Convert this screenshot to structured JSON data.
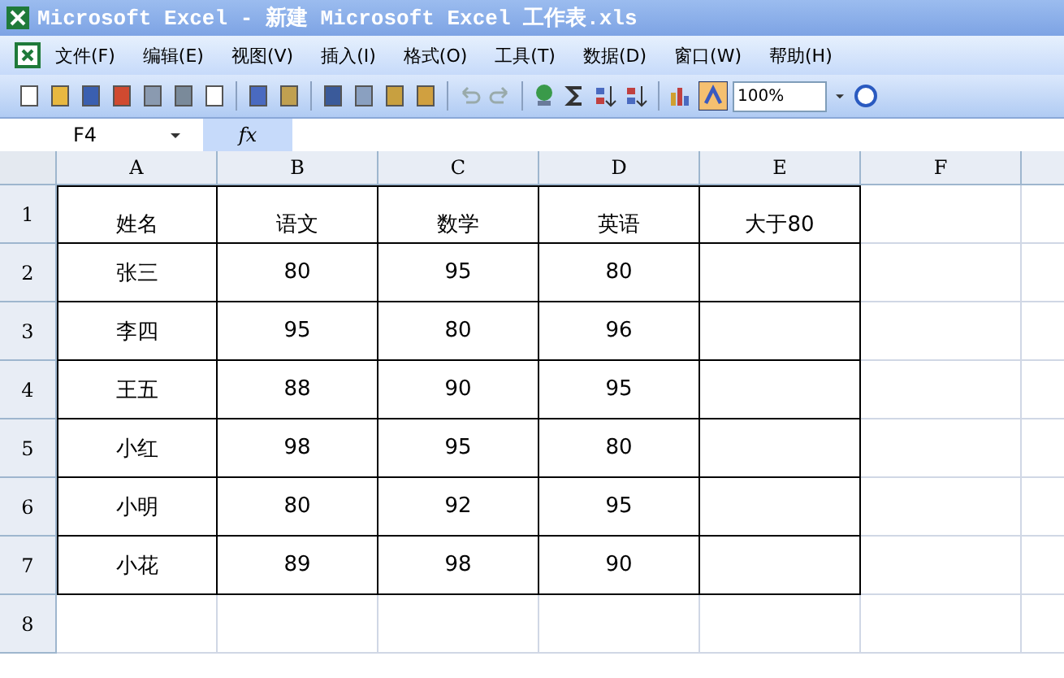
{
  "window": {
    "title": "Microsoft Excel - 新建 Microsoft Excel 工作表.xls"
  },
  "menu": [
    "文件(F)",
    "编辑(E)",
    "视图(V)",
    "插入(I)",
    "格式(O)",
    "工具(T)",
    "数据(D)",
    "窗口(W)",
    "帮助(H)"
  ],
  "toolbar": {
    "zoom": "100%"
  },
  "formula_bar": {
    "name_box": "F4",
    "fx": "fx"
  },
  "sheet": {
    "columns": [
      "A",
      "B",
      "C",
      "D",
      "E",
      "F"
    ],
    "rows": [
      {
        "number": "1",
        "cells": [
          "姓名",
          "语文",
          "数学",
          "英语",
          "大于80"
        ]
      },
      {
        "number": "2",
        "cells": [
          "张三",
          "80",
          "95",
          "80"
        ]
      },
      {
        "number": "3",
        "cells": [
          "李四",
          "95",
          "80",
          "96"
        ]
      },
      {
        "number": "4",
        "cells": [
          "王五",
          "88",
          "90",
          "95"
        ]
      },
      {
        "number": "5",
        "cells": [
          "小红",
          "98",
          "95",
          "80"
        ]
      },
      {
        "number": "6",
        "cells": [
          "小明",
          "80",
          "92",
          "95"
        ]
      },
      {
        "number": "7",
        "cells": [
          "小花",
          "89",
          "98",
          "90"
        ]
      },
      {
        "number": "8"
      }
    ]
  }
}
